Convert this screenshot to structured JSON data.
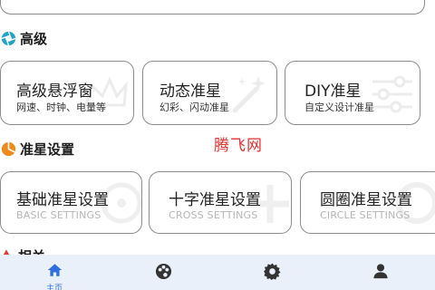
{
  "sections": {
    "advanced": {
      "title": "高级",
      "icon": "aperture-icon",
      "color": "#1ea5c9"
    },
    "crosshair_settings": {
      "title": "准星设置",
      "icon": "pie-icon",
      "color": "#f08a1c"
    },
    "partial": {
      "title": "相关",
      "icon": "warning-icon",
      "color": "#e53935"
    }
  },
  "advanced_cards": [
    {
      "title": "高级悬浮窗",
      "subtitle": "网速、时钟、电量等"
    },
    {
      "title": "动态准星",
      "subtitle": "幻彩、闪动准星"
    },
    {
      "title": "DIY准星",
      "subtitle": "自定义设计准星"
    }
  ],
  "settings_cards": [
    {
      "title": "基础准星设置",
      "subtitle": "BASIC SETTINGS"
    },
    {
      "title": "十字准星设置",
      "subtitle": "CROSS SETTINGS"
    },
    {
      "title": "圆圈准星设置",
      "subtitle": "CIRCLE SETTINGS"
    }
  ],
  "watermark": "腾飞网",
  "bottom_nav": [
    {
      "icon": "home-icon",
      "label": "主页",
      "active": true
    },
    {
      "icon": "palette-icon",
      "label": "",
      "active": false
    },
    {
      "icon": "gear-icon",
      "label": "",
      "active": false
    },
    {
      "icon": "person-icon",
      "label": "",
      "active": false
    }
  ],
  "accent": "#2f6fe0"
}
